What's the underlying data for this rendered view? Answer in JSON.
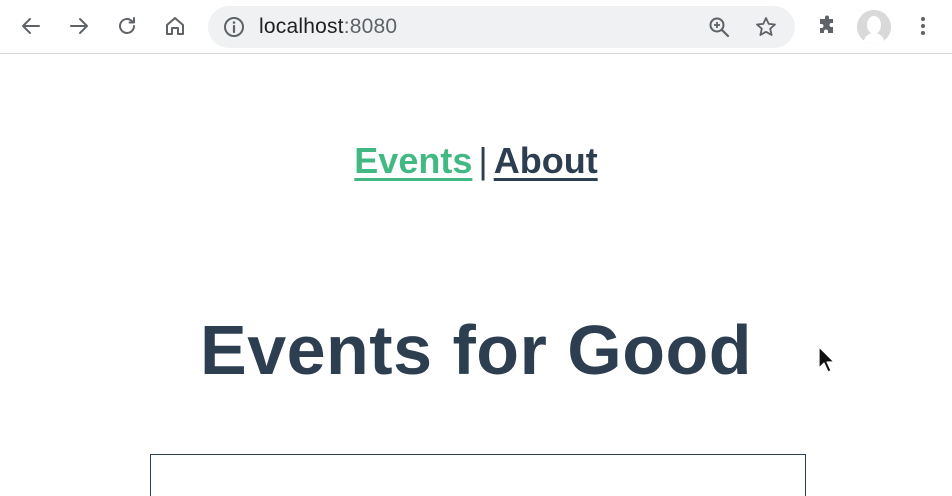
{
  "browser": {
    "url_host": "localhost",
    "url_port": ":8080",
    "icons": {
      "back": "arrow-left-icon",
      "forward": "arrow-right-icon",
      "reload": "reload-icon",
      "home": "home-icon",
      "info": "info-icon",
      "zoom": "zoom-in-icon",
      "bookmark": "star-icon",
      "extensions": "puzzle-icon",
      "profile": "avatar-icon",
      "menu": "kebab-menu-icon"
    }
  },
  "nav": {
    "events_label": "Events",
    "separator": "|",
    "about_label": "About"
  },
  "page": {
    "title": "Events for Good"
  },
  "colors": {
    "active_link": "#42b983",
    "text": "#2c3e50",
    "omnibox_bg": "#eff1f2"
  }
}
